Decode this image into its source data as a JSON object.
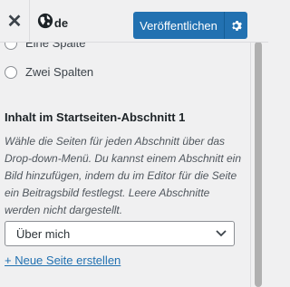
{
  "header": {
    "close_symbol": "✕",
    "language_code": "de",
    "publish_label": "Veröffentlichen"
  },
  "options": {
    "partial_label": "Eine Spalte",
    "two_columns_label": "Zwei Spalten"
  },
  "section": {
    "title": "Inhalt im Startseiten-Abschnitt 1",
    "description": "Wähle die Seiten für jeden Abschnitt über das Drop-down-Menü. Du kannst einem Abschnitt ein Bild hinzufügen, indem du im Editor für die Seite ein Beitragsbild festlegst. Leere Abschnitte werden nicht dargestellt.",
    "select_value": "Über mich",
    "new_page_link": "+ Neue Seite erstellen"
  },
  "colors": {
    "accent": "#2271b1",
    "background": "#f0f0f1"
  }
}
